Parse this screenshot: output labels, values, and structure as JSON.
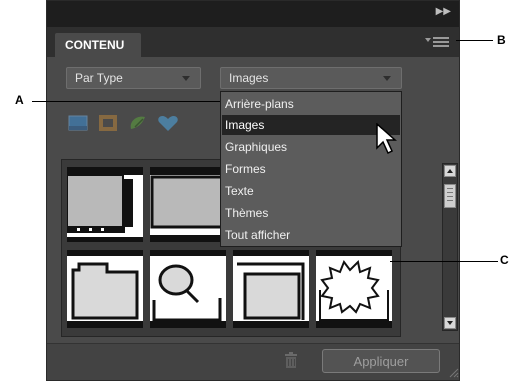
{
  "panel": {
    "tab_label": "CONTENU",
    "expand_icon": "double-chevron-right-icon",
    "menu_icon": "panel-menu-icon"
  },
  "filters": {
    "type_select": "Par Type",
    "category_select": "Images"
  },
  "dropdown": {
    "items": [
      {
        "label": "Arrière-plans",
        "selected": false
      },
      {
        "label": "Images",
        "selected": true
      },
      {
        "label": "Graphiques",
        "selected": false
      },
      {
        "label": "Formes",
        "selected": false
      },
      {
        "label": "Texte",
        "selected": false
      },
      {
        "label": "Thèmes",
        "selected": false
      },
      {
        "label": "Tout afficher",
        "selected": false
      }
    ]
  },
  "icon_row": [
    "background-icon",
    "frame-icon",
    "graphic-icon",
    "shape-icon"
  ],
  "footer": {
    "trash_icon": "trash-icon",
    "apply_label": "Appliquer"
  },
  "callouts": {
    "a": "A",
    "b": "B",
    "c": "C"
  },
  "colors": {
    "panel_bg": "#4a4a4a",
    "header_bg": "#1e1e1e",
    "selected_item": "#242424"
  }
}
